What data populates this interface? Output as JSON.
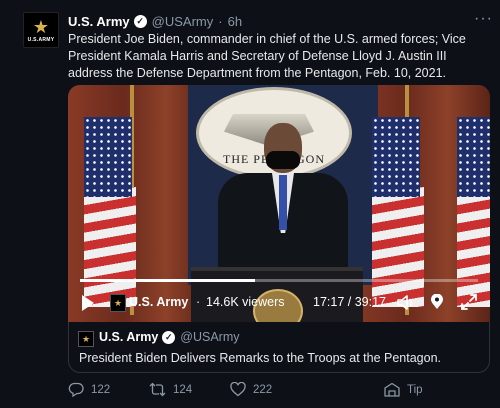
{
  "tweet": {
    "account_name": "U.S. Army",
    "handle": "@USArmy",
    "separator": "·",
    "time": "6h",
    "more_label": "···",
    "avatar_label": "U.S.ARMY",
    "text": "President Joe Biden, commander in chief of the U.S. armed forces; Vice President Kamala Harris and Secretary of Defense Lloyd J. Austin III address the Defense Department from the Pentagon, Feb. 10, 2021."
  },
  "video": {
    "seal_text": "THE PENTAGON",
    "channel_name": "U.S. Army",
    "separator": "·",
    "viewers": "14.6K viewers",
    "time": "17:17 / 39:17",
    "progress": 0.44
  },
  "quote": {
    "account_name": "U.S. Army",
    "handle": "@USArmy",
    "text": "President Biden Delivers Remarks to the Troops at the Pentagon."
  },
  "actions": {
    "replies": "122",
    "retweets": "124",
    "likes": "222",
    "tip": "Tip"
  },
  "colors": {
    "background": "#0d1117",
    "text": "#e7e9ea",
    "muted": "#8b98a5",
    "border": "#2f3336"
  }
}
